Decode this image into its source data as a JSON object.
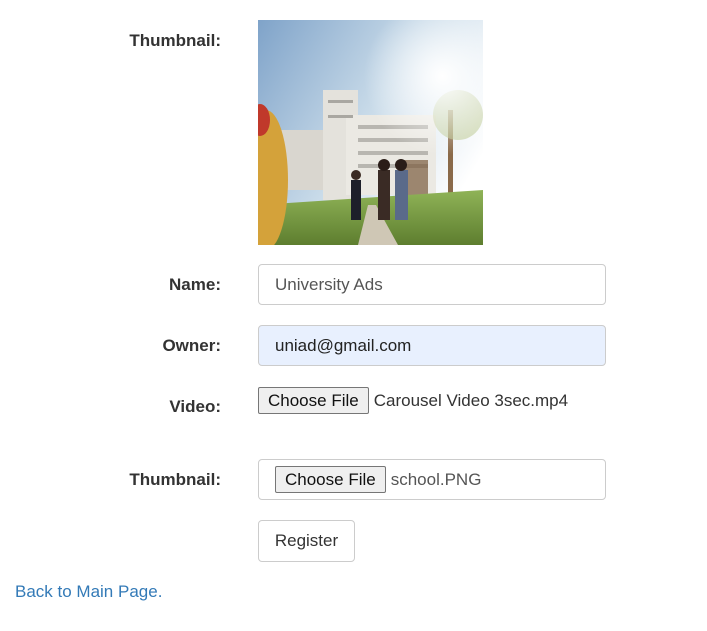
{
  "form": {
    "thumbnail_label": "Thumbnail:",
    "name_label": "Name:",
    "name_value": "University Ads",
    "owner_label": "Owner:",
    "owner_value": "uniad@gmail.com",
    "video_label": "Video:",
    "video_button": "Choose File",
    "video_file": "Carousel Video 3sec.mp4",
    "thumbnail_upload_label": "Thumbnail:",
    "thumbnail_button": "Choose File",
    "thumbnail_file": "school.PNG",
    "register_label": "Register"
  },
  "footer": {
    "back_link": "Back to Main Page."
  },
  "colors": {
    "link": "#337ab7",
    "autofill_bg": "#e8f0fe",
    "input_border": "#cccccc"
  },
  "thumbnail_preview": {
    "icon": "campus-photo"
  }
}
